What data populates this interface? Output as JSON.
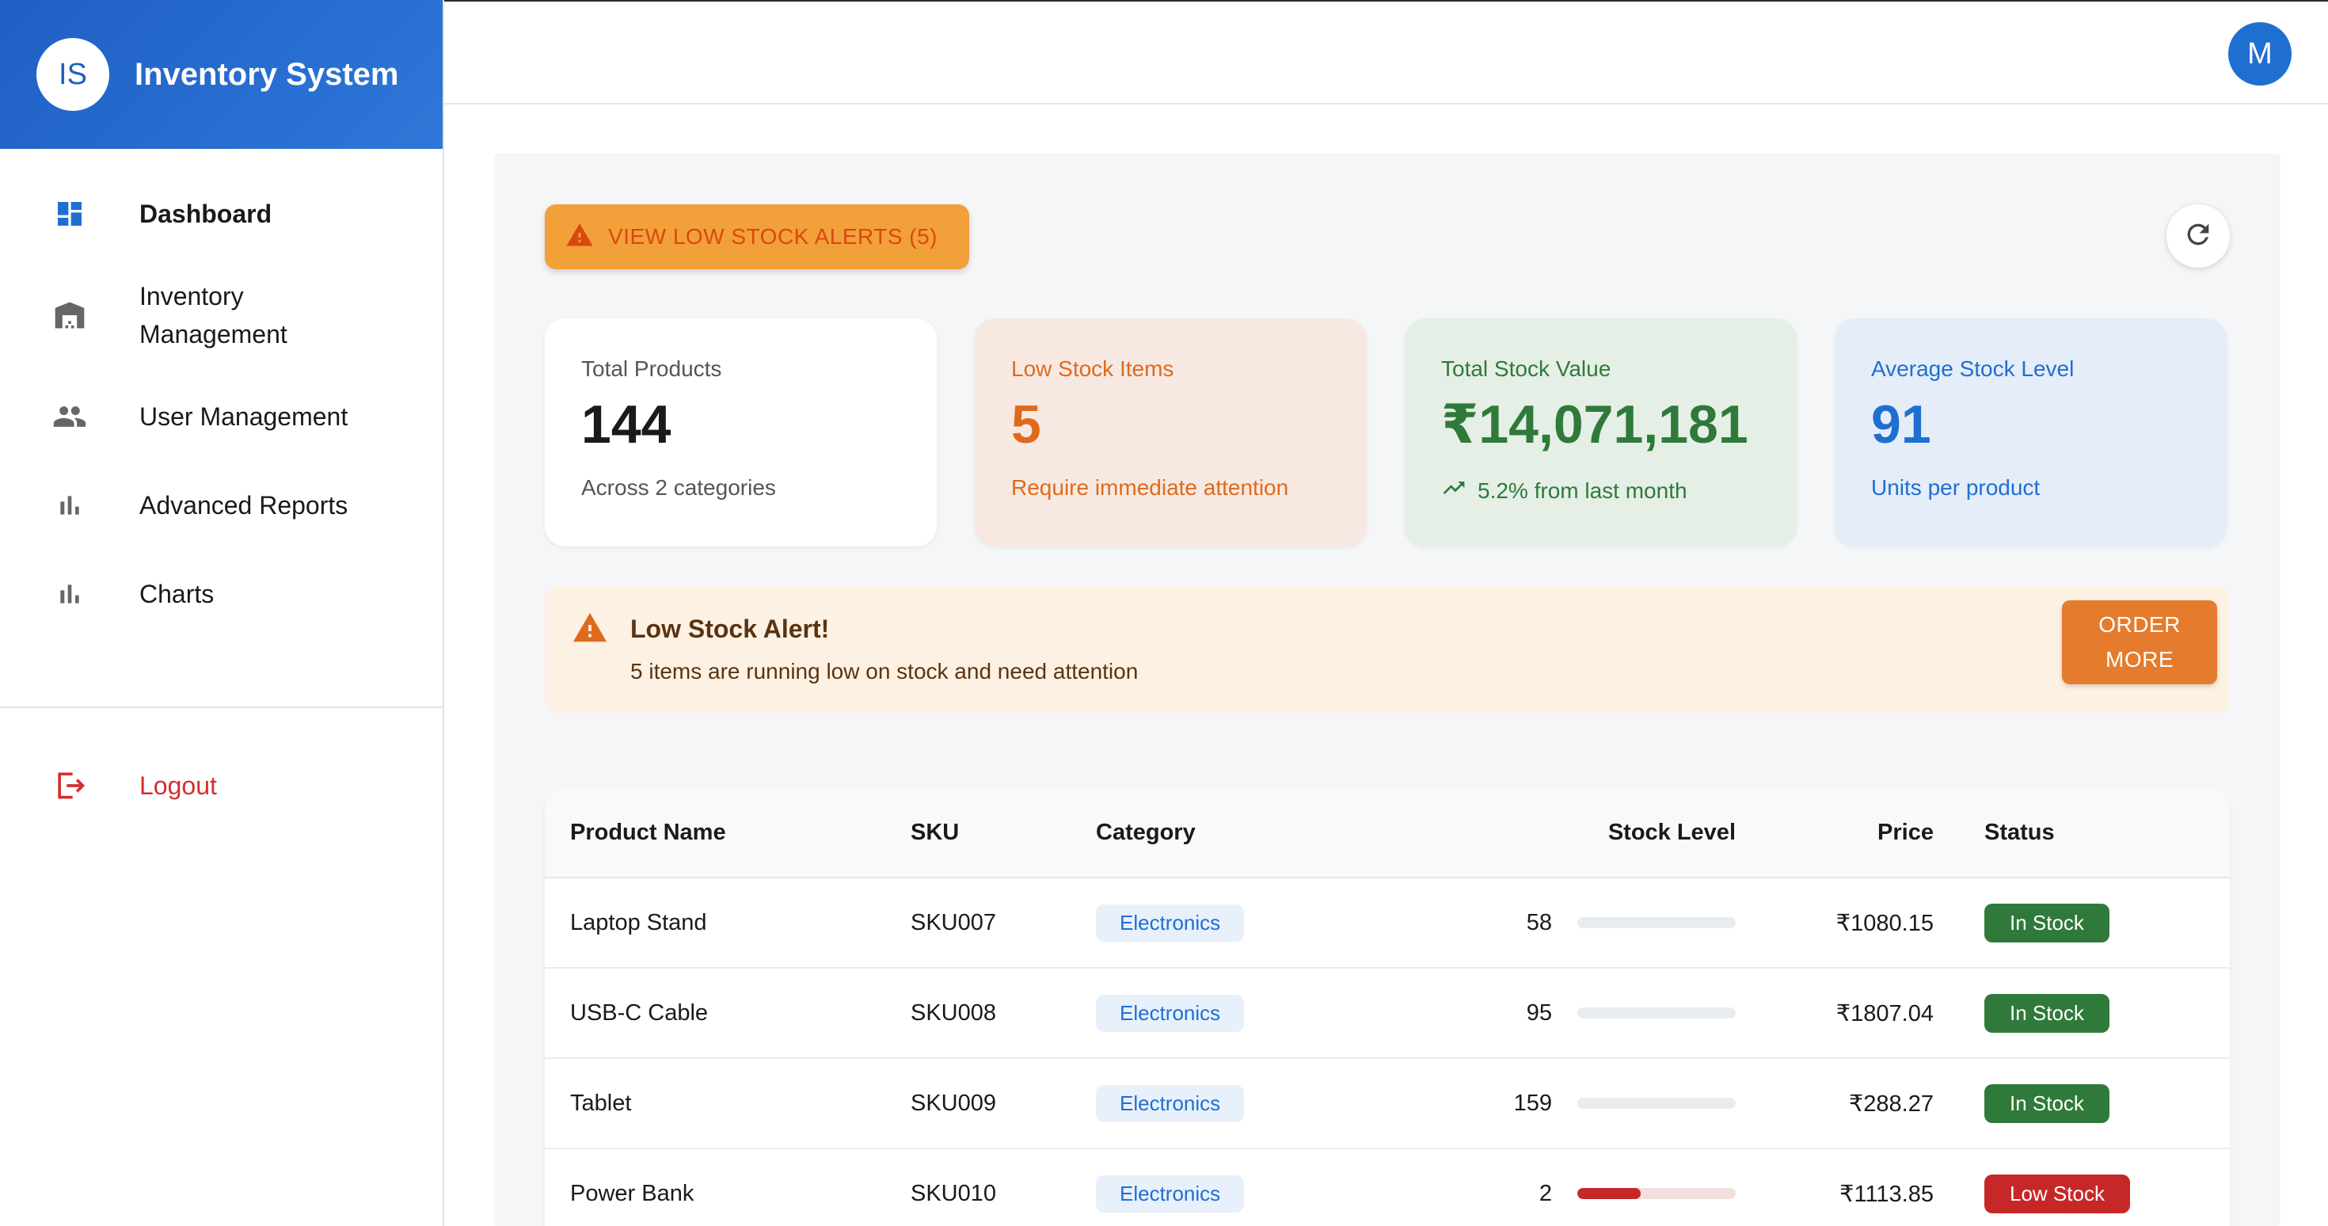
{
  "brand": {
    "logo_text": "IS",
    "title": "Inventory System"
  },
  "nav": {
    "items": [
      {
        "label": "Dashboard",
        "icon": "dashboard-icon"
      },
      {
        "label": "Inventory Management",
        "icon": "warehouse-icon"
      },
      {
        "label": "User Management",
        "icon": "people-icon"
      },
      {
        "label": "Advanced Reports",
        "icon": "bar-chart-icon"
      },
      {
        "label": "Charts",
        "icon": "bar-chart-icon"
      }
    ],
    "logout_label": "Logout"
  },
  "topbar": {
    "avatar_initial": "M"
  },
  "actions": {
    "low_stock_alerts_label": "VIEW LOW STOCK ALERTS (5)",
    "refresh_icon": "refresh-icon"
  },
  "cards": [
    {
      "label": "Total Products",
      "value": "144",
      "sub": "Across 2 categories"
    },
    {
      "label": "Low Stock Items",
      "value": "5",
      "sub": "Require immediate attention"
    },
    {
      "label": "Total Stock Value",
      "value": "₹14,071,181",
      "sub": "5.2% from last month",
      "sub_icon": "trending-up-icon"
    },
    {
      "label": "Average Stock Level",
      "value": "91",
      "sub": "Units per product"
    }
  ],
  "low_stock_banner": {
    "title": "Low Stock Alert!",
    "message": "5 items are running low on stock and need attention",
    "button_line1": "ORDER",
    "button_line2": "MORE"
  },
  "table": {
    "headers": {
      "name": "Product Name",
      "sku": "SKU",
      "category": "Category",
      "stock": "Stock Level",
      "price": "Price",
      "status": "Status"
    },
    "rows": [
      {
        "name": "Laptop Stand",
        "sku": "SKU007",
        "category": "Electronics",
        "stock": "58",
        "stock_fill": 0,
        "price": "₹1080.15",
        "status": "In Stock",
        "low": false
      },
      {
        "name": "USB-C Cable",
        "sku": "SKU008",
        "category": "Electronics",
        "stock": "95",
        "stock_fill": 0,
        "price": "₹1807.04",
        "status": "In Stock",
        "low": false
      },
      {
        "name": "Tablet",
        "sku": "SKU009",
        "category": "Electronics",
        "stock": "159",
        "stock_fill": 0,
        "price": "₹288.27",
        "status": "In Stock",
        "low": false
      },
      {
        "name": "Power Bank",
        "sku": "SKU010",
        "category": "Electronics",
        "stock": "2",
        "stock_fill": 0.4,
        "price": "₹1113.85",
        "status": "Low Stock",
        "low": true
      }
    ]
  },
  "colors": {
    "brand_blue": "#1f5fc4",
    "warning_orange": "#f2a03a",
    "success_green": "#2f7a3a",
    "danger_red": "#c62828"
  }
}
